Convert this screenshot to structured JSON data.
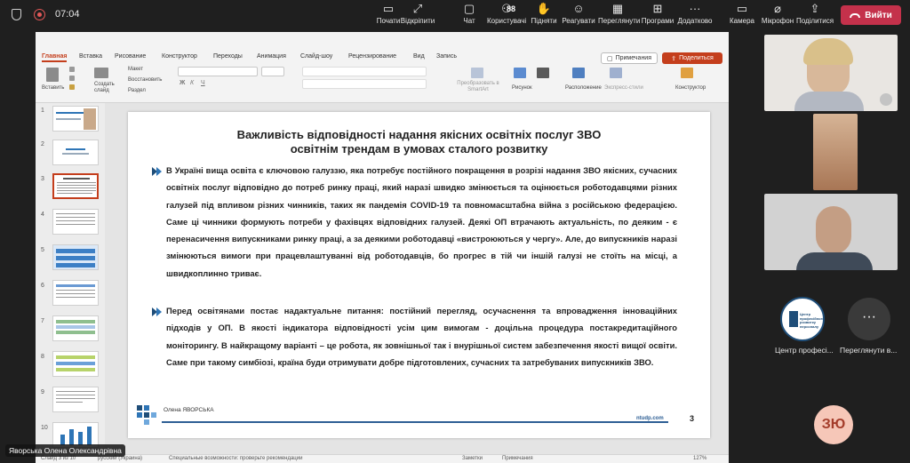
{
  "teams": {
    "time": "07:04",
    "toolbar": [
      {
        "label": "Почати",
        "icon": "whiteboard-icon"
      },
      {
        "label": "Відкріпити",
        "icon": "unpin-icon"
      },
      {
        "label": "Чат",
        "icon": "chat-icon"
      },
      {
        "label": "Користувачі",
        "icon": "people-icon",
        "count": "88"
      },
      {
        "label": "Підняти",
        "icon": "raise-hand-icon"
      },
      {
        "label": "Реагувати",
        "icon": "react-icon"
      },
      {
        "label": "Переглянути",
        "icon": "view-icon"
      },
      {
        "label": "Програми",
        "icon": "apps-icon"
      },
      {
        "label": "Додатково",
        "icon": "more-icon"
      },
      {
        "label": "Камера",
        "icon": "camera-icon"
      },
      {
        "label": "Мікрофон",
        "icon": "mic-off-icon"
      },
      {
        "label": "Поділитися",
        "icon": "share-icon"
      }
    ],
    "leave_label": "Вийти",
    "presenter_name": "Яворська Олена Олександрівна",
    "participants": {
      "org_caption": "Центр професі...",
      "org_logo_text": "Центр професійного розвитку персоналу",
      "more_caption": "Переглянути в...",
      "avatar_initials": "ЗЮ"
    },
    "accent": "#c4314b"
  },
  "ppt": {
    "tabs": [
      "Главная",
      "Вставка",
      "Рисование",
      "Конструктор",
      "Переходы",
      "Анимация",
      "Слайд-шоу",
      "Рецензирование",
      "Вид",
      "Запись"
    ],
    "comments_label": "Примечания",
    "share_label": "Поделиться",
    "ribbon": {
      "paste": "Вставить",
      "new_slide": "Создать слайд",
      "layout": "Макет",
      "reset": "Восстановить",
      "section": "Раздел",
      "smartart": "Преобразовать в SmartArt",
      "picture": "Рисунок",
      "arrange": "Расположение",
      "quick_styles": "Экспресс-стили",
      "designer": "Конструктор"
    },
    "thumb_numbers": [
      "1",
      "2",
      "3",
      "4",
      "5",
      "6",
      "7",
      "8",
      "9",
      "10"
    ],
    "selected_slide": "3",
    "slide": {
      "title_line1": "Важливість відповідності надання якісних освітніх послуг ЗВО",
      "title_line2": "освітнім трендам в умовах сталого розвитку",
      "para1": "В Україні вища освіта є ключовою галуззю, яка потребує постійного покращення в розрізі надання ЗВО якісних, сучасних освітніх послуг відповідно до потреб ринку праці, який наразі швидко змінюється та оцінюється роботодавцями різних галузей під впливом різних чинників, таких як пандемія COVID-19 та повномасштабна війна з російською федерацією. Саме ці чинники формують потреби у фахівцях відповідних галузей. Деякі ОП втрачають актуальність, по деяким - є перенасичення випускниками ринку праці, а за деякими роботодавці «вистроюються у чергу». Але, до випускників наразі змінюються вимоги при працевлаштуванні від роботодавців, бо прогрес в тій чи іншій галузі  не стоїть на місці, а швидкоплинно триває.",
      "para2": "Перед освітянами постає надактуальне питання: постійний перегляд, осучаснення та впровадження інноваційних підходів у ОП. В якості індикатора відповідності усім цим вимогам - доцільна процедура постакредитаційного моніторингу. В найкращому варіанті – це робота, як зовнішньої так і внурішньої систем забезпечення якості вищої освіти. Саме при такому симбіозі, країна буди отримувати добре підготовлених, сучасних та затребуваних випускників ЗВО.",
      "author": "Олена ЯВОРСЬКА",
      "site": "ntudp.com",
      "page_number": "3"
    },
    "status": {
      "slide_info": "Слайд 3 из 10",
      "language": "русский (Украина)",
      "accessibility": "Специальные возможности: проверьте рекомендации",
      "notes": "Заметки",
      "comments": "Примечания",
      "zoom": "127%"
    },
    "accent": "#c43e1c"
  }
}
